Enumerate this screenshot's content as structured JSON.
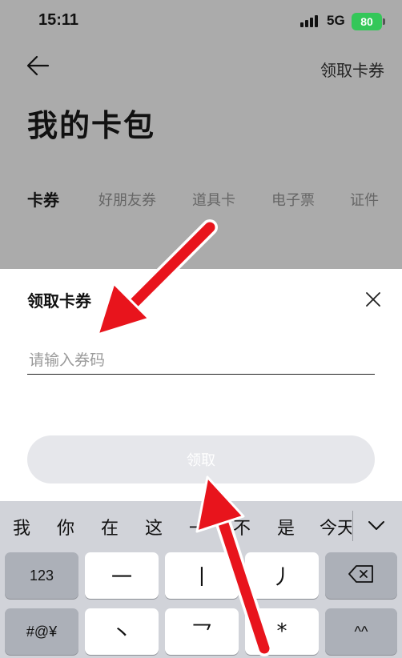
{
  "status_bar": {
    "time": "15:11",
    "network": "5G",
    "battery": "80"
  },
  "header": {
    "right_link": "领取卡券",
    "title": "我的卡包"
  },
  "tabs": [
    "卡券",
    "好朋友券",
    "道具卡",
    "电子票",
    "证件"
  ],
  "sheet": {
    "title": "领取卡券",
    "input_placeholder": "请输入券码",
    "input_value": "",
    "submit_label": "领取"
  },
  "keyboard": {
    "candidates": [
      "我",
      "你",
      "在",
      "这",
      "一",
      "不",
      "是",
      "今天"
    ],
    "row1": {
      "mode_key": "123",
      "keys": [
        "一",
        "丨",
        "丿"
      ],
      "delete": "delete-icon"
    },
    "row2": {
      "mode_key": "#@¥",
      "keys": [
        "丶",
        "乛",
        "*"
      ],
      "shift": "^^"
    }
  },
  "colors": {
    "arrow": "#e8141c",
    "battery": "#34c759",
    "dim_overlay": "#ababab"
  }
}
